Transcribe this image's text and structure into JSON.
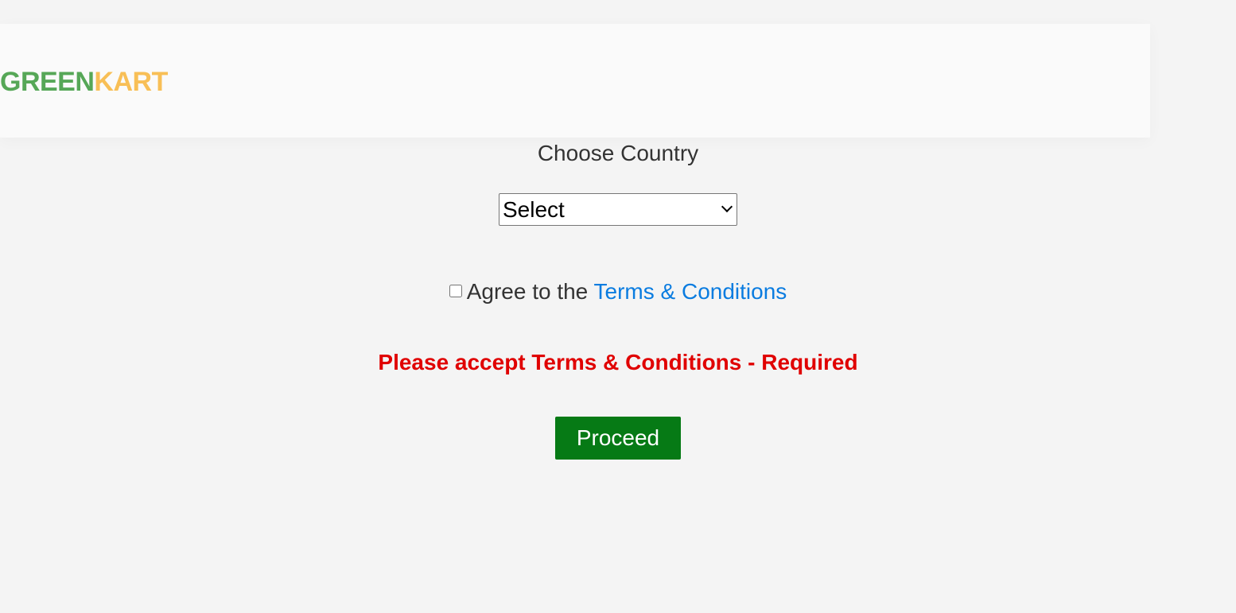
{
  "header": {
    "logo_part1": "GREEN",
    "logo_part2": "KART"
  },
  "country": {
    "label": "Choose Country",
    "selected": "Select",
    "options": [
      "Select"
    ]
  },
  "terms": {
    "agree_text": "Agree to the ",
    "link_text": "Terms & Conditions",
    "checked": false
  },
  "error": {
    "message": "Please accept Terms & Conditions - Required"
  },
  "actions": {
    "proceed_label": "Proceed"
  },
  "colors": {
    "background": "#f4f4f4",
    "header_background": "#fafafa",
    "logo_green": "#56a757",
    "logo_kart": "#f8bf56",
    "link": "#0a7ce0",
    "error": "#e00000",
    "proceed_button": "#067a15"
  }
}
